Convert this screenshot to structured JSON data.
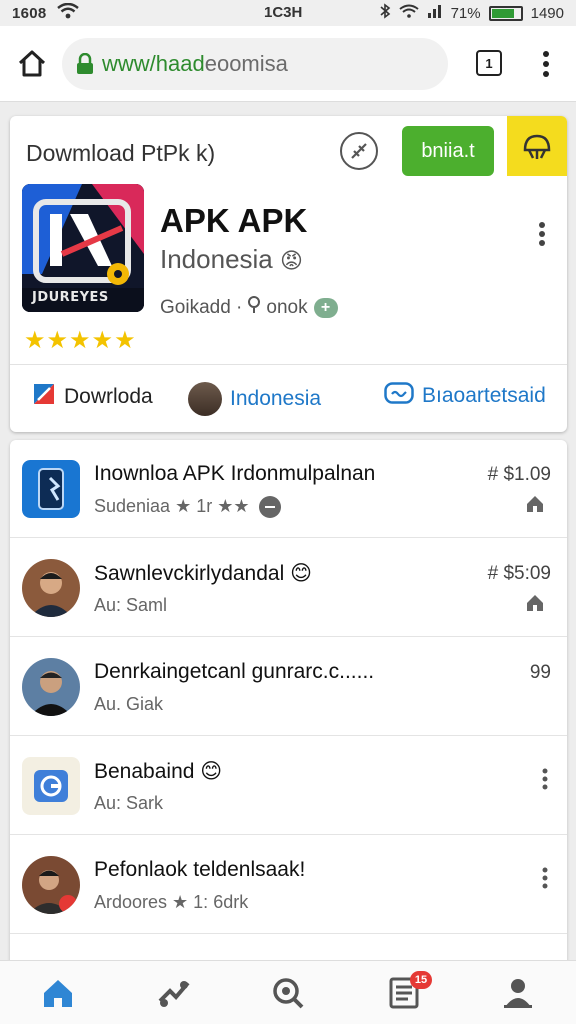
{
  "status_bar": {
    "time": "1608",
    "center": "1C3H",
    "signal_text": "71%",
    "battery_text": "1490"
  },
  "browser": {
    "url_green": "www/haad",
    "url_grey": "eoomisa",
    "tabs_count": "1"
  },
  "app_card": {
    "header_title": "Dowmload PtPk k)",
    "get_button": "bniia.t",
    "app_name": "APK APK",
    "app_subtitle": "Indonesia",
    "emoji": "😡",
    "meta_text": "Goikadd · ",
    "meta_text2": "onok",
    "plus_label": "+",
    "stars": "★★★★★",
    "logo_caption": "JDUREYES",
    "chips": [
      {
        "label": "Dowrloda"
      },
      {
        "label": "Indonesia"
      },
      {
        "label": "Bıaoartetsaid"
      }
    ],
    "colors": {
      "get_button": "#4caf2e",
      "accent_corner": "#f4dc1e",
      "link": "#1f78c8",
      "star": "#f3c300"
    }
  },
  "list": [
    {
      "title": "Inownloa APK Irdonmulpalnan",
      "sub": "Sudeniaa ★ 1r ★★",
      "price": "# $1.09",
      "thumb": "phone-app-icon"
    },
    {
      "title": "Sawnlevckirlydandal 😊",
      "sub": "Au: Saml",
      "price": "# $5:09",
      "thumb": "person-avatar"
    },
    {
      "title": "Denrkaingetcanl gunrarc.c......",
      "sub": "Au. Giak",
      "price": "99",
      "thumb": "person-avatar"
    },
    {
      "title": "Benabaind 😊",
      "sub": "Au: Sark",
      "price": "",
      "thumb": "email-app-icon"
    },
    {
      "title": "Pefonlaok teldenlsaak!",
      "sub": "Ardoores ★ 1: 6drk",
      "price": "",
      "thumb": "person-avatar"
    }
  ],
  "bottom_nav": {
    "badge": "15",
    "items": [
      "home-icon",
      "apps-icon",
      "search-icon",
      "list-icon",
      "account-icon"
    ]
  }
}
